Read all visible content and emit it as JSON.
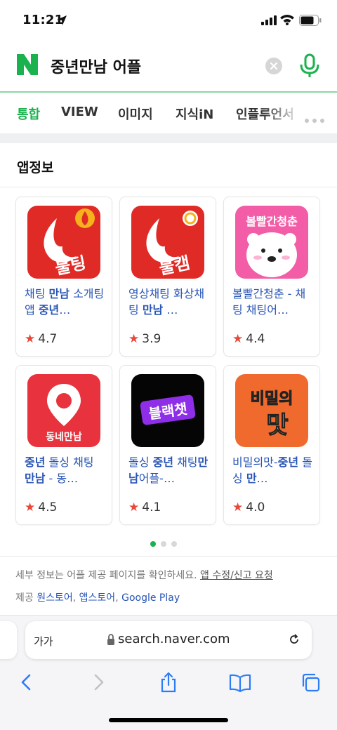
{
  "status_bar": {
    "time": "11:21"
  },
  "search": {
    "query": "중년만남 어플"
  },
  "tabs": [
    {
      "label": "통합"
    },
    {
      "label": "VIEW"
    },
    {
      "label": "이미지"
    },
    {
      "label": "지식iN"
    },
    {
      "label": "인플루언서"
    }
  ],
  "section": {
    "title": "앱정보"
  },
  "apps": [
    {
      "name": "채팅 만남 소개팅앱 중년…",
      "name_html": "채팅 <b>만남</b> 소개팅앱 <b>중년</b>…",
      "rating": "4.7",
      "icon": "flame-app-icon"
    },
    {
      "name": "영상채팅 화상채팅 만남 …",
      "name_html": "영상채팅 화상채팅 <b>만남</b> …",
      "rating": "3.9",
      "icon": "flame-cam-app-icon"
    },
    {
      "name": "볼빨간청춘 - 채팅 채팅어…",
      "name_html": "볼빨간청춘 - 채팅 채팅어…",
      "rating": "4.4",
      "icon": "polar-bear-app-icon"
    },
    {
      "name": "중년 돌싱 채팅 만남 - 동…",
      "name_html": "<b>중년</b> 돌싱 채팅 <b>만남</b> - 동…",
      "rating": "4.5",
      "icon": "map-pin-app-icon"
    },
    {
      "name": "돌싱 중년 채팅만남어플-…",
      "name_html": "돌싱 <b>중년</b> 채팅<b>만남</b>어플-…",
      "rating": "4.1",
      "icon": "black-chat-app-icon"
    },
    {
      "name": "비밀의맛-중년 돌싱 만…",
      "name_html": "비밀의맛-<b>중년</b> 돌싱 <b>만</b>…",
      "rating": "4.0",
      "icon": "secret-taste-app-icon"
    }
  ],
  "icon_text": {
    "app1": "불팅",
    "app2": "불캠",
    "app3": "볼빨간청춘",
    "app4": "동네만남",
    "app5": "블랙챗",
    "app6_line1": "비밀의",
    "app6_line2": "맛"
  },
  "footer": {
    "notice": "세부 정보는 어플 제공 페이지를 확인하세요.",
    "report_link": "앱 수정/신고 요청",
    "provider_label": "제공",
    "providers": [
      "원스토어",
      "앱스토어",
      "Google Play"
    ]
  },
  "browser": {
    "text_size": "가가",
    "url": "search.naver.com"
  },
  "colors": {
    "naver_green": "#19b24e",
    "link_blue": "#2855b5",
    "star_red": "#e8473a"
  }
}
